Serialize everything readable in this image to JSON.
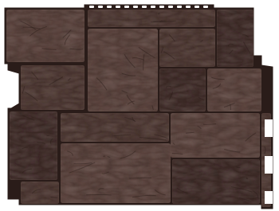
{
  "product": {
    "name": "facade-panel-dark-brown-stone",
    "colors": {
      "background": "#ffffff",
      "base": "#4a3530",
      "block_light": "#5a423c",
      "block_mid": "#4d3732",
      "block_dark": "#3f2c28",
      "seam": "#2a1c19",
      "highlight": "#6b524b",
      "nail_slot": "#ffffff"
    }
  }
}
